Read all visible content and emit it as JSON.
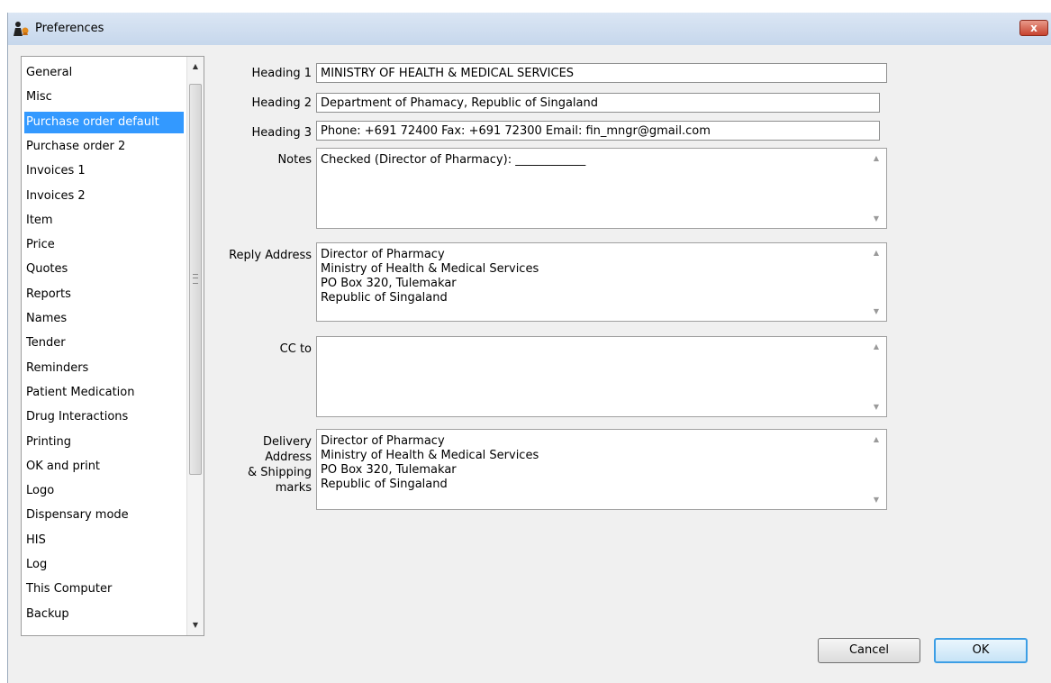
{
  "window": {
    "title": "Preferences",
    "close_label": "x"
  },
  "sidebar": {
    "items": [
      {
        "label": "General",
        "selected": false
      },
      {
        "label": "Misc",
        "selected": false
      },
      {
        "label": "Purchase order default",
        "selected": true
      },
      {
        "label": "Purchase order 2",
        "selected": false
      },
      {
        "label": "Invoices 1",
        "selected": false
      },
      {
        "label": "Invoices 2",
        "selected": false
      },
      {
        "label": "Item",
        "selected": false
      },
      {
        "label": "Price",
        "selected": false
      },
      {
        "label": "Quotes",
        "selected": false
      },
      {
        "label": "Reports",
        "selected": false
      },
      {
        "label": "Names",
        "selected": false
      },
      {
        "label": "Tender",
        "selected": false
      },
      {
        "label": "Reminders",
        "selected": false
      },
      {
        "label": "Patient Medication",
        "selected": false
      },
      {
        "label": "Drug Interactions",
        "selected": false
      },
      {
        "label": "Printing",
        "selected": false
      },
      {
        "label": "OK and print",
        "selected": false
      },
      {
        "label": "Logo",
        "selected": false
      },
      {
        "label": "Dispensary mode",
        "selected": false
      },
      {
        "label": "HIS",
        "selected": false
      },
      {
        "label": "Log",
        "selected": false
      },
      {
        "label": "This Computer",
        "selected": false
      },
      {
        "label": "Backup",
        "selected": false
      }
    ]
  },
  "form": {
    "heading1": {
      "label": "Heading 1",
      "value": "MINISTRY OF HEALTH & MEDICAL SERVICES"
    },
    "heading2": {
      "label": "Heading 2",
      "value": "Department of Phamacy, Republic of Singaland"
    },
    "heading3": {
      "label": "Heading 3",
      "value": "Phone: +691 72400  Fax: +691 72300  Email: fin_mngr@gmail.com"
    },
    "notes": {
      "label": "Notes",
      "value": "Checked (Director of Pharmacy): ____________"
    },
    "reply_address": {
      "label": "Reply Address",
      "value": "Director of Pharmacy\nMinistry of Health & Medical Services\nPO Box 320, Tulemakar\nRepublic of Singaland"
    },
    "cc_to": {
      "label": "CC to",
      "value": ""
    },
    "delivery_address": {
      "label_lines": [
        "Delivery",
        "Address",
        "& Shipping",
        "marks"
      ],
      "value": "Director of Pharmacy\nMinistry of Health & Medical Services\nPO Box 320, Tulemakar\nRepublic of Singaland"
    }
  },
  "buttons": {
    "cancel": "Cancel",
    "ok": "OK"
  },
  "colors": {
    "selection": "#3399ff",
    "ok_border": "#3c9ee5",
    "titlebar": "#c6d7ec"
  }
}
